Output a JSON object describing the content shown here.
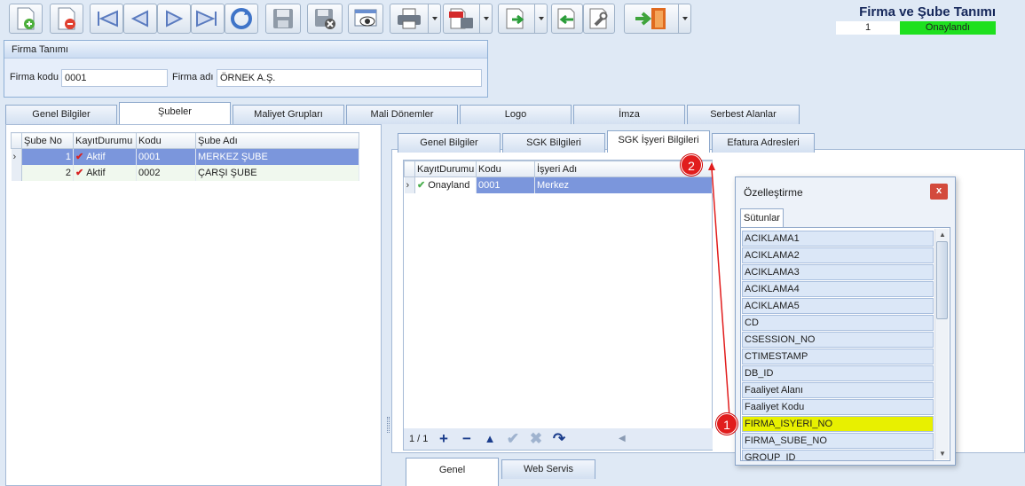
{
  "toolbar": {
    "buttons": [
      {
        "name": "new-record-icon"
      },
      {
        "name": "delete-record-icon"
      },
      {
        "name": "first-record-icon"
      },
      {
        "name": "previous-record-icon"
      },
      {
        "name": "next-record-icon"
      },
      {
        "name": "last-record-icon"
      },
      {
        "name": "refresh-icon"
      },
      {
        "name": "save-icon"
      },
      {
        "name": "cancel-save-icon"
      },
      {
        "name": "preview-icon"
      },
      {
        "name": "print-icon"
      },
      {
        "name": "pdf-export-icon"
      },
      {
        "name": "export-icon"
      },
      {
        "name": "import-icon"
      },
      {
        "name": "tools-icon"
      },
      {
        "name": "exit-door-icon"
      }
    ]
  },
  "header": {
    "title": "Firma ve Şube Tanımı",
    "record_no": "1",
    "status": "Onaylandı",
    "status_color": "#1ee01e"
  },
  "firma": {
    "group_title": "Firma Tanımı",
    "code_label": "Firma kodu",
    "code_value": "0001",
    "name_label": "Firma adı",
    "name_value": "ÖRNEK A.Ş."
  },
  "main_tabs": [
    "Genel Bilgiler",
    "Şubeler",
    "Maliyet Grupları",
    "Mali Dönemler",
    "Logo",
    "İmza",
    "Serbest Alanlar"
  ],
  "active_main_tab": "Şubeler",
  "sube_grid": {
    "columns": [
      "Şube No",
      "KayıtDurumu",
      "Kodu",
      "Şube Adı"
    ],
    "rows": [
      {
        "no": "1",
        "durum": "Aktif",
        "kod": "0001",
        "ad": "MERKEZ ŞUBE",
        "selected": true
      },
      {
        "no": "2",
        "durum": "Aktif",
        "kod": "0002",
        "ad": "ÇARŞI ŞUBE",
        "selected": false
      }
    ]
  },
  "sub_tabs": [
    "Genel Bilgiler",
    "SGK Bilgileri",
    "SGK İşyeri Bilgileri",
    "Efatura Adresleri"
  ],
  "active_sub_tab": "SGK İşyeri Bilgileri",
  "isyeri_grid": {
    "columns": [
      "KayıtDurumu",
      "Kodu",
      "İşyeri Adı"
    ],
    "rows": [
      {
        "durum": "Onayland",
        "kod": "0001",
        "ad": "Merkez"
      }
    ]
  },
  "navigator": {
    "page": "1 / 1",
    "icons": [
      "add-icon",
      "remove-icon",
      "move-up-icon",
      "confirm-icon",
      "cancel-icon",
      "undo-icon"
    ]
  },
  "bottom_tabs": [
    "Genel",
    "Web Servis"
  ],
  "active_bottom_tab": "Genel",
  "dialog": {
    "title": "Özelleştirme",
    "close": "x",
    "tab": "Sütunlar",
    "items": [
      "ACIKLAMA1",
      "ACIKLAMA2",
      "ACIKLAMA3",
      "ACIKLAMA4",
      "ACIKLAMA5",
      "CD",
      "CSESSION_NO",
      "CTIMESTAMP",
      "DB_ID",
      "Faaliyet Alanı",
      "Faaliyet Kodu",
      "FIRMA_ISYERI_NO",
      "FIRMA_SUBE_NO",
      "GROUP_ID"
    ],
    "highlighted": "FIRMA_ISYERI_NO"
  },
  "callouts": {
    "one": "1",
    "two": "2"
  }
}
